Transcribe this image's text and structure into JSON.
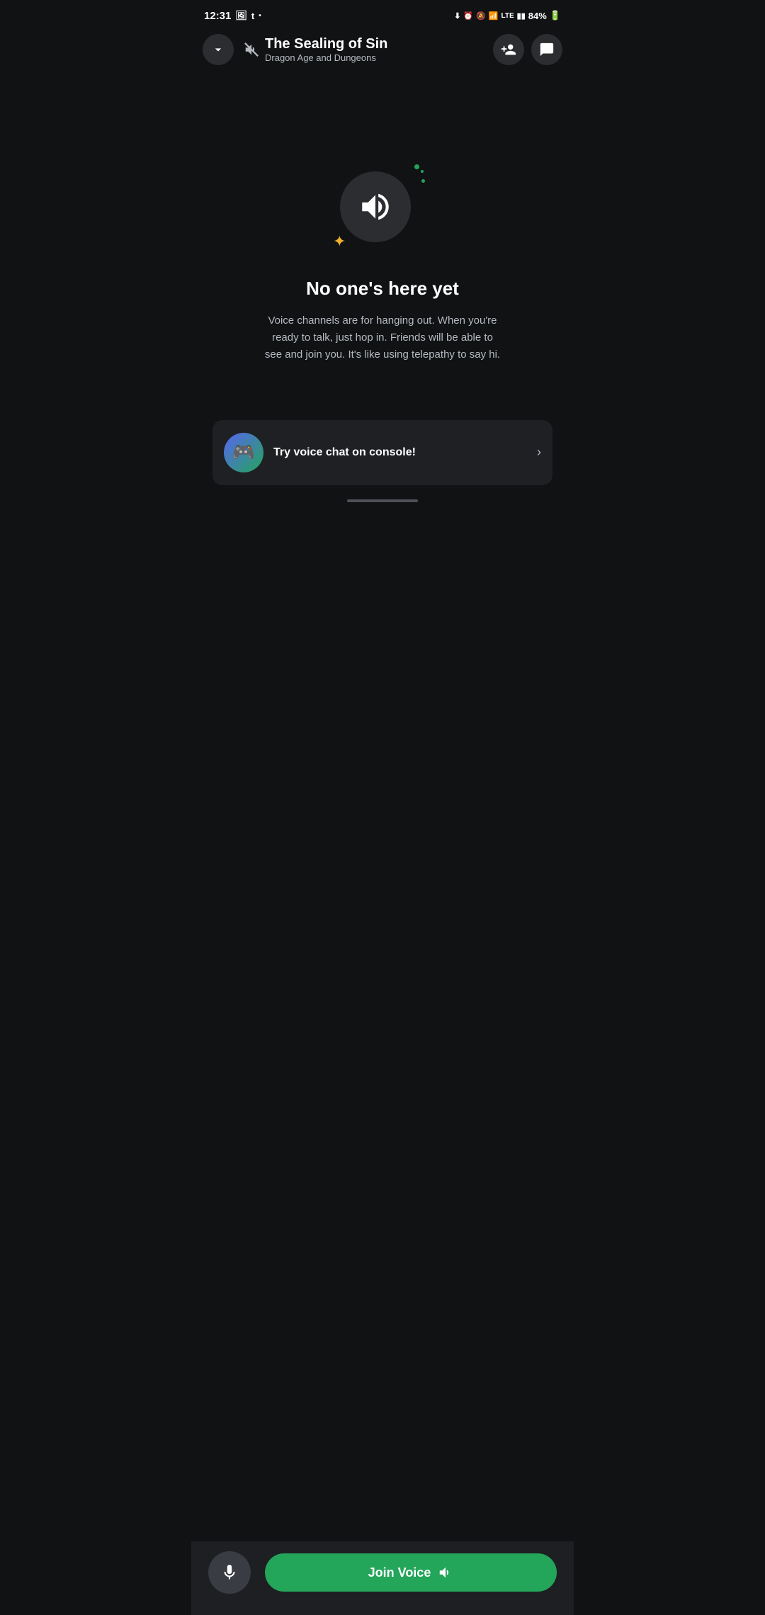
{
  "statusBar": {
    "time": "12:31",
    "battery": "84%"
  },
  "header": {
    "backIcon": "chevron-down",
    "muteIcon": "🔇",
    "title": "The Sealing of Sin",
    "subtitle": "Dragon Age and Dungeons",
    "addMemberLabel": "Add Member",
    "chatLabel": "Chat"
  },
  "emptyState": {
    "title": "No one's here yet",
    "description": "Voice channels are for hanging out. When you're ready to talk, just hop in. Friends will be able to see and join you. It's like using telepathy to say hi."
  },
  "consoleBanner": {
    "icon": "🎮",
    "text": "Try voice chat on console!",
    "chevron": "›"
  },
  "bottomBar": {
    "micLabel": "Microphone",
    "joinVoiceLabel": "Join Voice"
  }
}
